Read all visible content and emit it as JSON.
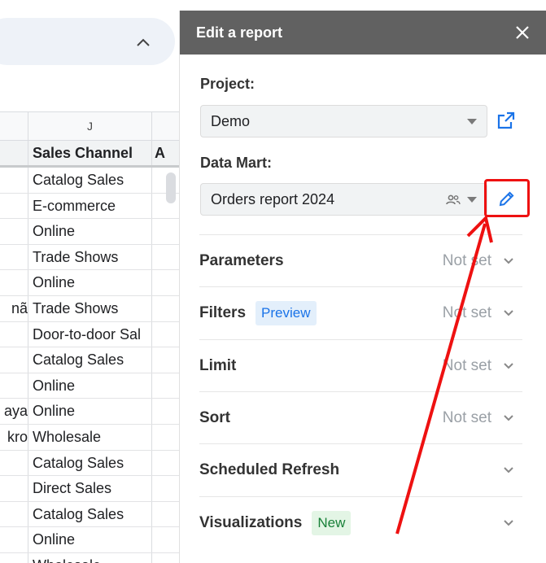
{
  "sheet": {
    "column_letter": "J",
    "header": {
      "channel": "Sales Channel",
      "next": "A"
    },
    "rows": [
      {
        "left": "",
        "channel": "Catalog Sales"
      },
      {
        "left": "",
        "channel": "E-commerce"
      },
      {
        "left": "",
        "channel": "Online"
      },
      {
        "left": "",
        "channel": "Trade Shows"
      },
      {
        "left": "",
        "channel": "Online"
      },
      {
        "left": "nã",
        "channel": "Trade Shows"
      },
      {
        "left": "",
        "channel": "Door-to-door Sal"
      },
      {
        "left": "",
        "channel": "Catalog Sales"
      },
      {
        "left": "",
        "channel": "Online"
      },
      {
        "left": "aya",
        "channel": "Online"
      },
      {
        "left": "kro",
        "channel": "Wholesale"
      },
      {
        "left": "",
        "channel": "Catalog Sales"
      },
      {
        "left": "",
        "channel": "Direct Sales"
      },
      {
        "left": "",
        "channel": "Catalog Sales"
      },
      {
        "left": "",
        "channel": "Online"
      },
      {
        "left": "",
        "channel": "Wholesale"
      }
    ]
  },
  "panel": {
    "title": "Edit a report",
    "project_label": "Project:",
    "project_value": "Demo",
    "data_mart_label": "Data Mart:",
    "data_mart_value": "Orders report 2024",
    "sections": [
      {
        "title": "Parameters",
        "status": "Not set",
        "badge": ""
      },
      {
        "title": "Filters",
        "status": "Not set",
        "badge": "Preview"
      },
      {
        "title": "Limit",
        "status": "Not set",
        "badge": ""
      },
      {
        "title": "Sort",
        "status": "Not set",
        "badge": ""
      },
      {
        "title": "Scheduled Refresh",
        "status": "",
        "badge": ""
      },
      {
        "title": "Visualizations",
        "status": "",
        "badge": "New"
      }
    ]
  },
  "colors": {
    "header_bg": "#616161",
    "accent_blue": "#1a73e8",
    "annotation_red": "#ee1111",
    "badge_new_green": "#188038"
  },
  "icons": [
    "chevron-up-icon",
    "close-icon",
    "open-external-icon",
    "people-icon",
    "edit-pencil-icon",
    "chevron-down-icon"
  ]
}
